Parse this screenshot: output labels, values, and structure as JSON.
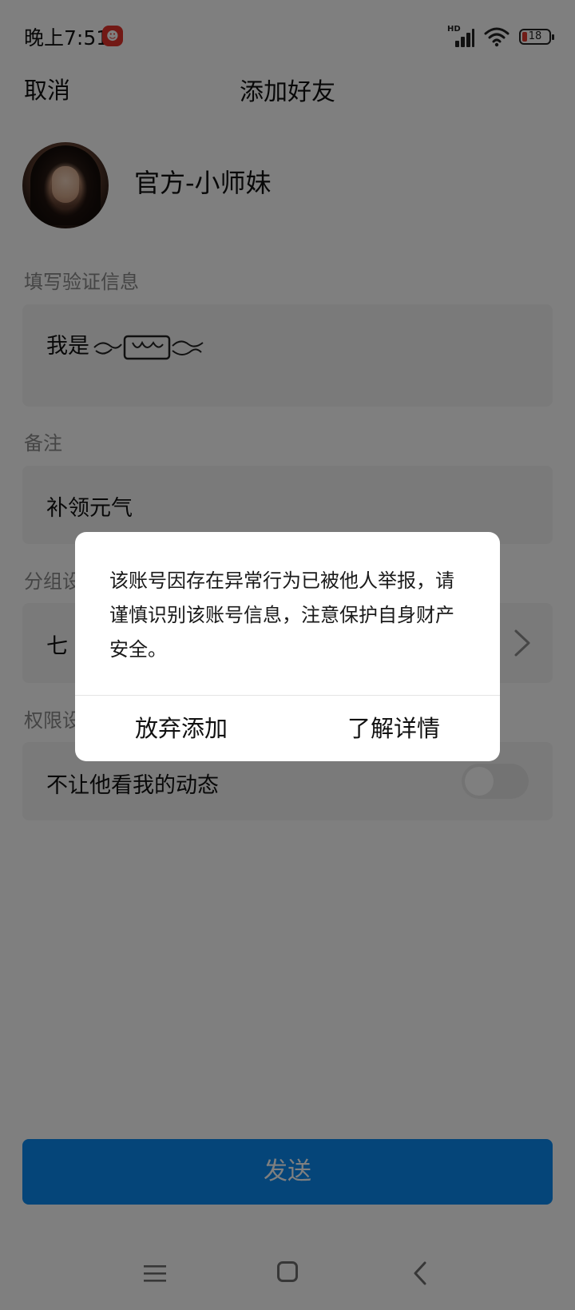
{
  "status_bar": {
    "time": "晚上7:51",
    "signal_label": "HD",
    "battery_level": "18"
  },
  "header": {
    "cancel_label": "取消",
    "title": "添加好友"
  },
  "profile": {
    "name": "官方-小师妹"
  },
  "verify": {
    "label": "填写验证信息",
    "text": "我是"
  },
  "remark": {
    "label": "备注",
    "value": "补领元气"
  },
  "group": {
    "label": "分组设置",
    "value": "七"
  },
  "permission": {
    "label": "权限设置",
    "item_label": "不让他看我的动态",
    "toggle_on": false
  },
  "send_label": "发送",
  "dialog": {
    "message": "该账号因存在异常行为已被他人举报，请谨慎识别该账号信息，注意保护自身财产安全。",
    "left_button": "放弃添加",
    "right_button": "了解详情"
  },
  "colors": {
    "accent": "#0a8af2",
    "overlay": "rgba(0,0,0,0.5)"
  },
  "icons": {
    "app_notification": "red-app-icon",
    "nav_menu": "menu-icon",
    "nav_home": "home-square-icon",
    "nav_back": "back-chevron-icon",
    "group_chevron": "chevron-right-icon"
  }
}
